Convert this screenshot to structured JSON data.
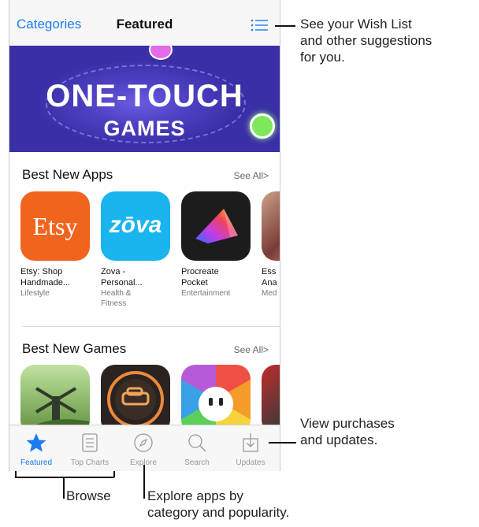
{
  "navbar": {
    "left_label": "Categories",
    "title": "Featured"
  },
  "banner": {
    "title": "ONE-TOUCH",
    "subtitle": "GAMES"
  },
  "sections": [
    {
      "title": "Best New Apps",
      "see_all": "See All>",
      "apps": [
        {
          "name_line1": "Etsy: Shop",
          "name_line2": "Handmade...",
          "category_line1": "Lifestyle",
          "category_line2": "",
          "icon_text": "Etsy",
          "icon_color": "#f1641e"
        },
        {
          "name_line1": "Zova -",
          "name_line2": "Personal...",
          "category_line1": "Health &",
          "category_line2": "Fitness",
          "icon_text": "zōva",
          "icon_color": "#1ab4ee"
        },
        {
          "name_line1": "Procreate",
          "name_line2": "Pocket",
          "category_line1": "Entertainment",
          "category_line2": "",
          "icon_text": "",
          "icon_color": "#1c1c1c"
        },
        {
          "name_line1": "Ess",
          "name_line2": "Ana",
          "category_line1": "Med",
          "category_line2": "",
          "icon_text": "",
          "icon_color": "#8a6a5a"
        }
      ]
    },
    {
      "title": "Best New Games",
      "see_all": "See All>"
    }
  ],
  "tabs": [
    {
      "label": "Featured",
      "icon": "star-icon"
    },
    {
      "label": "Top Charts",
      "icon": "list-icon"
    },
    {
      "label": "Explore",
      "icon": "compass-icon"
    },
    {
      "label": "Search",
      "icon": "search-icon"
    },
    {
      "label": "Updates",
      "icon": "download-icon"
    }
  ],
  "callouts": {
    "wish_list_line1": "See your Wish List",
    "wish_list_line2": "and other suggestions",
    "wish_list_line3": "for you.",
    "purchases_line1": "View purchases",
    "purchases_line2": "and updates.",
    "browse": "Browse",
    "explore_line1": "Explore apps by",
    "explore_line2": "category and popularity."
  },
  "colors": {
    "accent": "#1a7cf4",
    "banner": "#3a2fa6"
  }
}
